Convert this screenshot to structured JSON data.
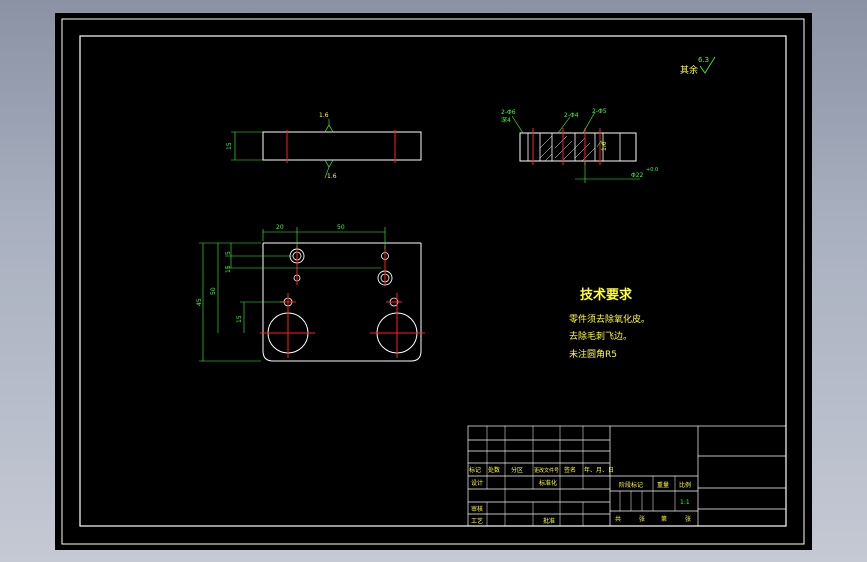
{
  "drawing": {
    "roughness_note": "其余",
    "roughness_value": "6.3",
    "side_view": {
      "roughness_top": "1.6",
      "roughness_bottom": "1.6",
      "thickness": "15"
    },
    "section_view": {
      "hole1": "2-Φ6",
      "hole1_depth": "深4",
      "hole2": "2-Φ4",
      "hole3": "2-Φ5",
      "roughness": "1.6",
      "slot": "Φ22",
      "tolerance": "+0.0"
    },
    "plan_view": {
      "dim_20": "20",
      "dim_50_top": "50",
      "dim_5": "5",
      "dim_15_a": "15",
      "dim_50_left": "50",
      "dim_15_b": "15",
      "dim_45": "45"
    },
    "tech_title": "技术要求",
    "tech_notes": [
      "零件须去除氧化皮。",
      "去除毛刺飞边。",
      "未注圆角R5"
    ]
  },
  "title_block": {
    "row_labels": [
      "标记",
      "处数",
      "分区",
      "更改文件号",
      "签名",
      "年、月、日"
    ],
    "design": "设计",
    "standard": "标准化",
    "stage_mark": "阶段标记",
    "weight": "重量",
    "scale": "比例",
    "scale_value": "1:1",
    "review": "审核",
    "process": "工艺",
    "approve": "批准",
    "sheet_total": "共",
    "sheet_of": "张",
    "sheet_no": "第",
    "sheet_unit": "张"
  }
}
